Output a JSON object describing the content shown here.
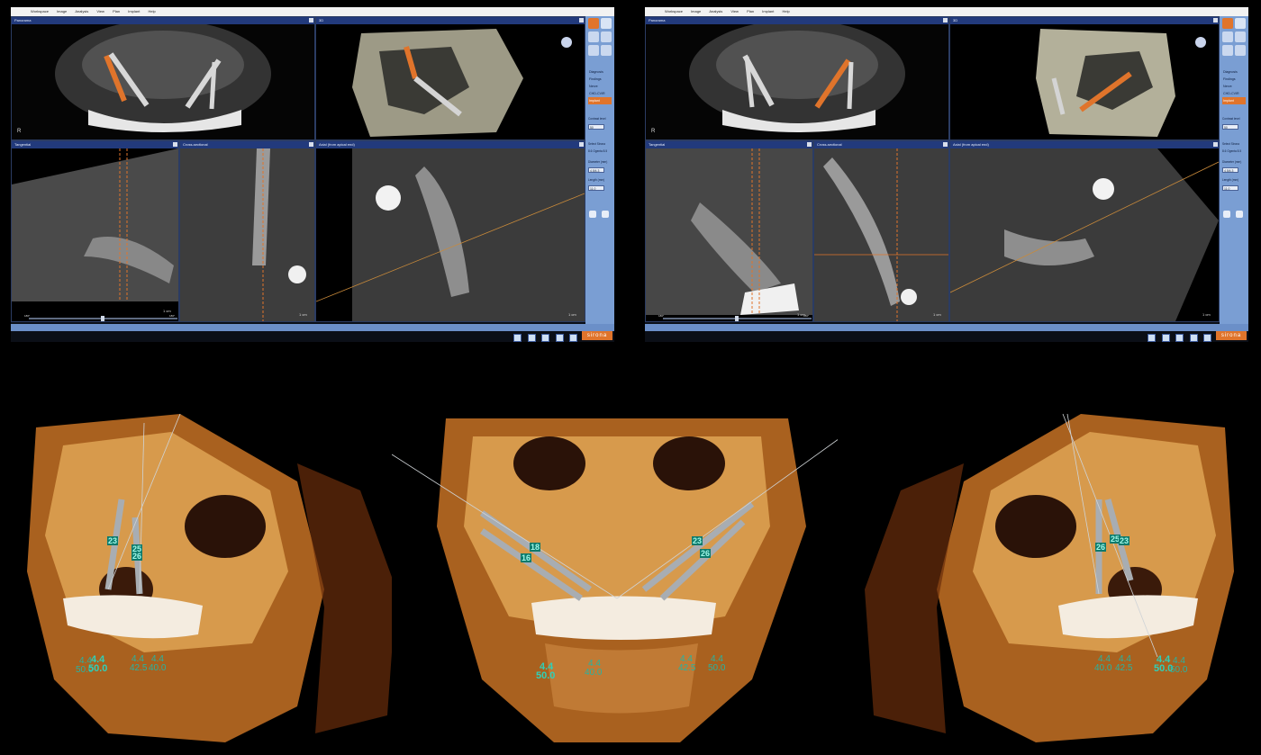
{
  "app": {
    "menu": [
      "Workspace",
      "Image",
      "Analysis",
      "View",
      "Plan",
      "Implant",
      "Help"
    ],
    "brand": "sirona"
  },
  "windows": [
    {
      "panes": {
        "panorama": "Panorama",
        "view3d": "3D",
        "tangential": "Tangential",
        "cross": "Cross-sectional",
        "axial": "Axial (from apical end)"
      },
      "side_list": [
        "Diagnosis",
        "Findings",
        "Nerve",
        "CHD-CVIR",
        "Implant"
      ],
      "fields": {
        "contrast_label": "Contrast level",
        "contrast_value": "50",
        "vendor_label": "Select Sirona",
        "vendor_value": "8.6 Ogenta 8.5",
        "diameter_label": "Diameter (mm)",
        "diameter_value": "4.5/4.3",
        "length_label": "Length (mm)",
        "length_value": "11.0"
      },
      "tabs": [
        "Panorama",
        "Tangential-Adjusted",
        "VRP-Analysis"
      ],
      "slider_left": "180°",
      "slider_right": "180°",
      "scale_a": "1 cm",
      "scale_b": "1 cm",
      "scale_c": "1 cm",
      "orient": "R"
    },
    {
      "panes": {
        "panorama": "Panorama",
        "view3d": "3D",
        "tangential": "Tangential",
        "cross": "Cross-sectional",
        "axial": "Axial (from apical end)"
      },
      "side_list": [
        "Diagnosis",
        "Findings",
        "Nerve",
        "CHD-CVIR",
        "Implant"
      ],
      "fields": {
        "contrast_label": "Contrast level",
        "contrast_value": "50",
        "vendor_label": "Select Sirona",
        "vendor_value": "8.6 Ogenta 8.5",
        "diameter_label": "Diameter (mm)",
        "diameter_value": "4.5/4.3",
        "length_label": "Length (mm)",
        "length_value": "11.0"
      },
      "tabs": [
        "Panorama",
        "Tangential-Adjusted",
        "VRP-Analysis"
      ],
      "slider_left": "180°",
      "slider_right": "180°",
      "scale_a": "1 cm",
      "scale_b": "1 cm",
      "scale_c": "1 cm",
      "orient": "R"
    }
  ],
  "renders": {
    "left": {
      "tags": [
        "23",
        "25",
        "26"
      ],
      "labels": [
        "4.4",
        "50.0",
        "4.4",
        "50.0",
        "4.4",
        "42.5",
        "4.4",
        "40.0"
      ]
    },
    "center": {
      "tags": [
        "18",
        "16",
        "23",
        "26"
      ],
      "labels": [
        "4.4",
        "50.0",
        "4.4",
        "40.0",
        "4.4",
        "42.5",
        "4.4",
        "50.0"
      ]
    },
    "right": {
      "tags": [
        "26",
        "25",
        "23"
      ],
      "labels": [
        "4.4",
        "40.0",
        "4.4",
        "42.5",
        "4.4",
        "50.0",
        "4.4",
        "50.0"
      ]
    }
  },
  "colors": {
    "panel_blue": "#7a9ed3",
    "title_blue": "#223a7c",
    "accent_orange": "#e0742b",
    "label_teal": "#27b3a2"
  }
}
